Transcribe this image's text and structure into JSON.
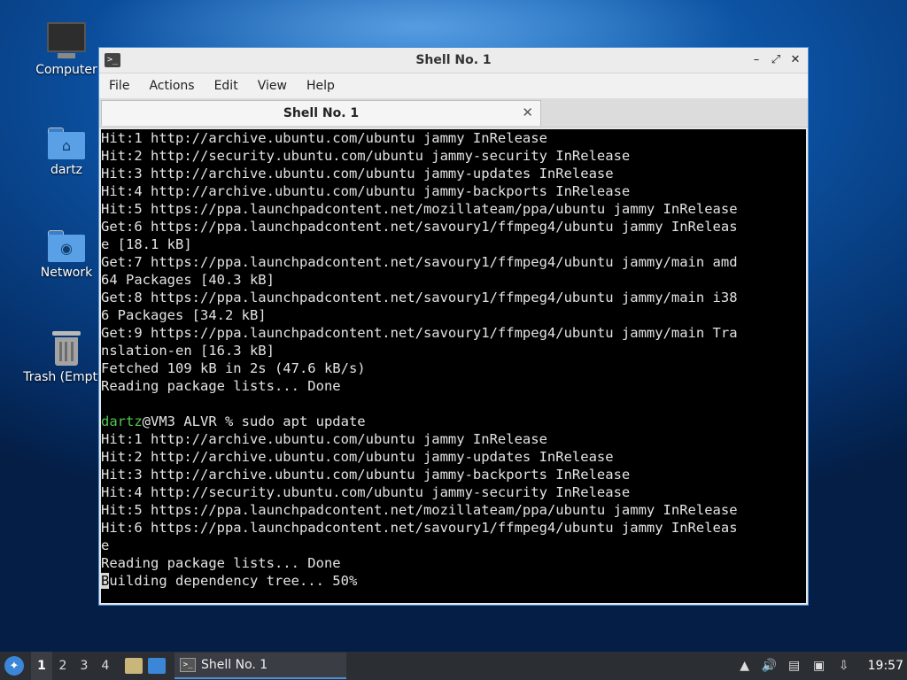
{
  "desktop": {
    "icons": [
      {
        "label": "Computer"
      },
      {
        "label": "dartz"
      },
      {
        "label": "Network"
      },
      {
        "label": "Trash (Empty)"
      }
    ]
  },
  "window": {
    "title": "Shell No. 1",
    "menu": [
      "File",
      "Actions",
      "Edit",
      "View",
      "Help"
    ],
    "tab_label": "Shell No. 1",
    "terminal_lines": [
      "Hit:1 http://archive.ubuntu.com/ubuntu jammy InRelease",
      "Hit:2 http://security.ubuntu.com/ubuntu jammy-security InRelease",
      "Hit:3 http://archive.ubuntu.com/ubuntu jammy-updates InRelease",
      "Hit:4 http://archive.ubuntu.com/ubuntu jammy-backports InRelease",
      "Hit:5 https://ppa.launchpadcontent.net/mozillateam/ppa/ubuntu jammy InRelease",
      "Get:6 https://ppa.launchpadcontent.net/savoury1/ffmpeg4/ubuntu jammy InReleas",
      "e [18.1 kB]",
      "Get:7 https://ppa.launchpadcontent.net/savoury1/ffmpeg4/ubuntu jammy/main amd",
      "64 Packages [40.3 kB]",
      "Get:8 https://ppa.launchpadcontent.net/savoury1/ffmpeg4/ubuntu jammy/main i38",
      "6 Packages [34.2 kB]",
      "Get:9 https://ppa.launchpadcontent.net/savoury1/ffmpeg4/ubuntu jammy/main Tra",
      "nslation-en [16.3 kB]",
      "Fetched 109 kB in 2s (47.6 kB/s)",
      "Reading package lists... Done",
      ""
    ],
    "prompt_user": "dartz",
    "prompt_rest": "@VM3 ALVR % sudo apt update",
    "terminal_lines_after": [
      "Hit:1 http://archive.ubuntu.com/ubuntu jammy InRelease",
      "Hit:2 http://archive.ubuntu.com/ubuntu jammy-updates InRelease",
      "Hit:3 http://archive.ubuntu.com/ubuntu jammy-backports InRelease",
      "Hit:4 http://security.ubuntu.com/ubuntu jammy-security InRelease",
      "Hit:5 https://ppa.launchpadcontent.net/mozillateam/ppa/ubuntu jammy InRelease",
      "Hit:6 https://ppa.launchpadcontent.net/savoury1/ffmpeg4/ubuntu jammy InReleas",
      "e",
      "Reading package lists... Done"
    ],
    "last_line_cursor_char": "B",
    "last_line_rest": "uilding dependency tree... 50%"
  },
  "taskbar": {
    "workspaces": [
      "1",
      "2",
      "3",
      "4"
    ],
    "active_workspace": "1",
    "task_label": "Shell No. 1",
    "clock": "19:57"
  }
}
